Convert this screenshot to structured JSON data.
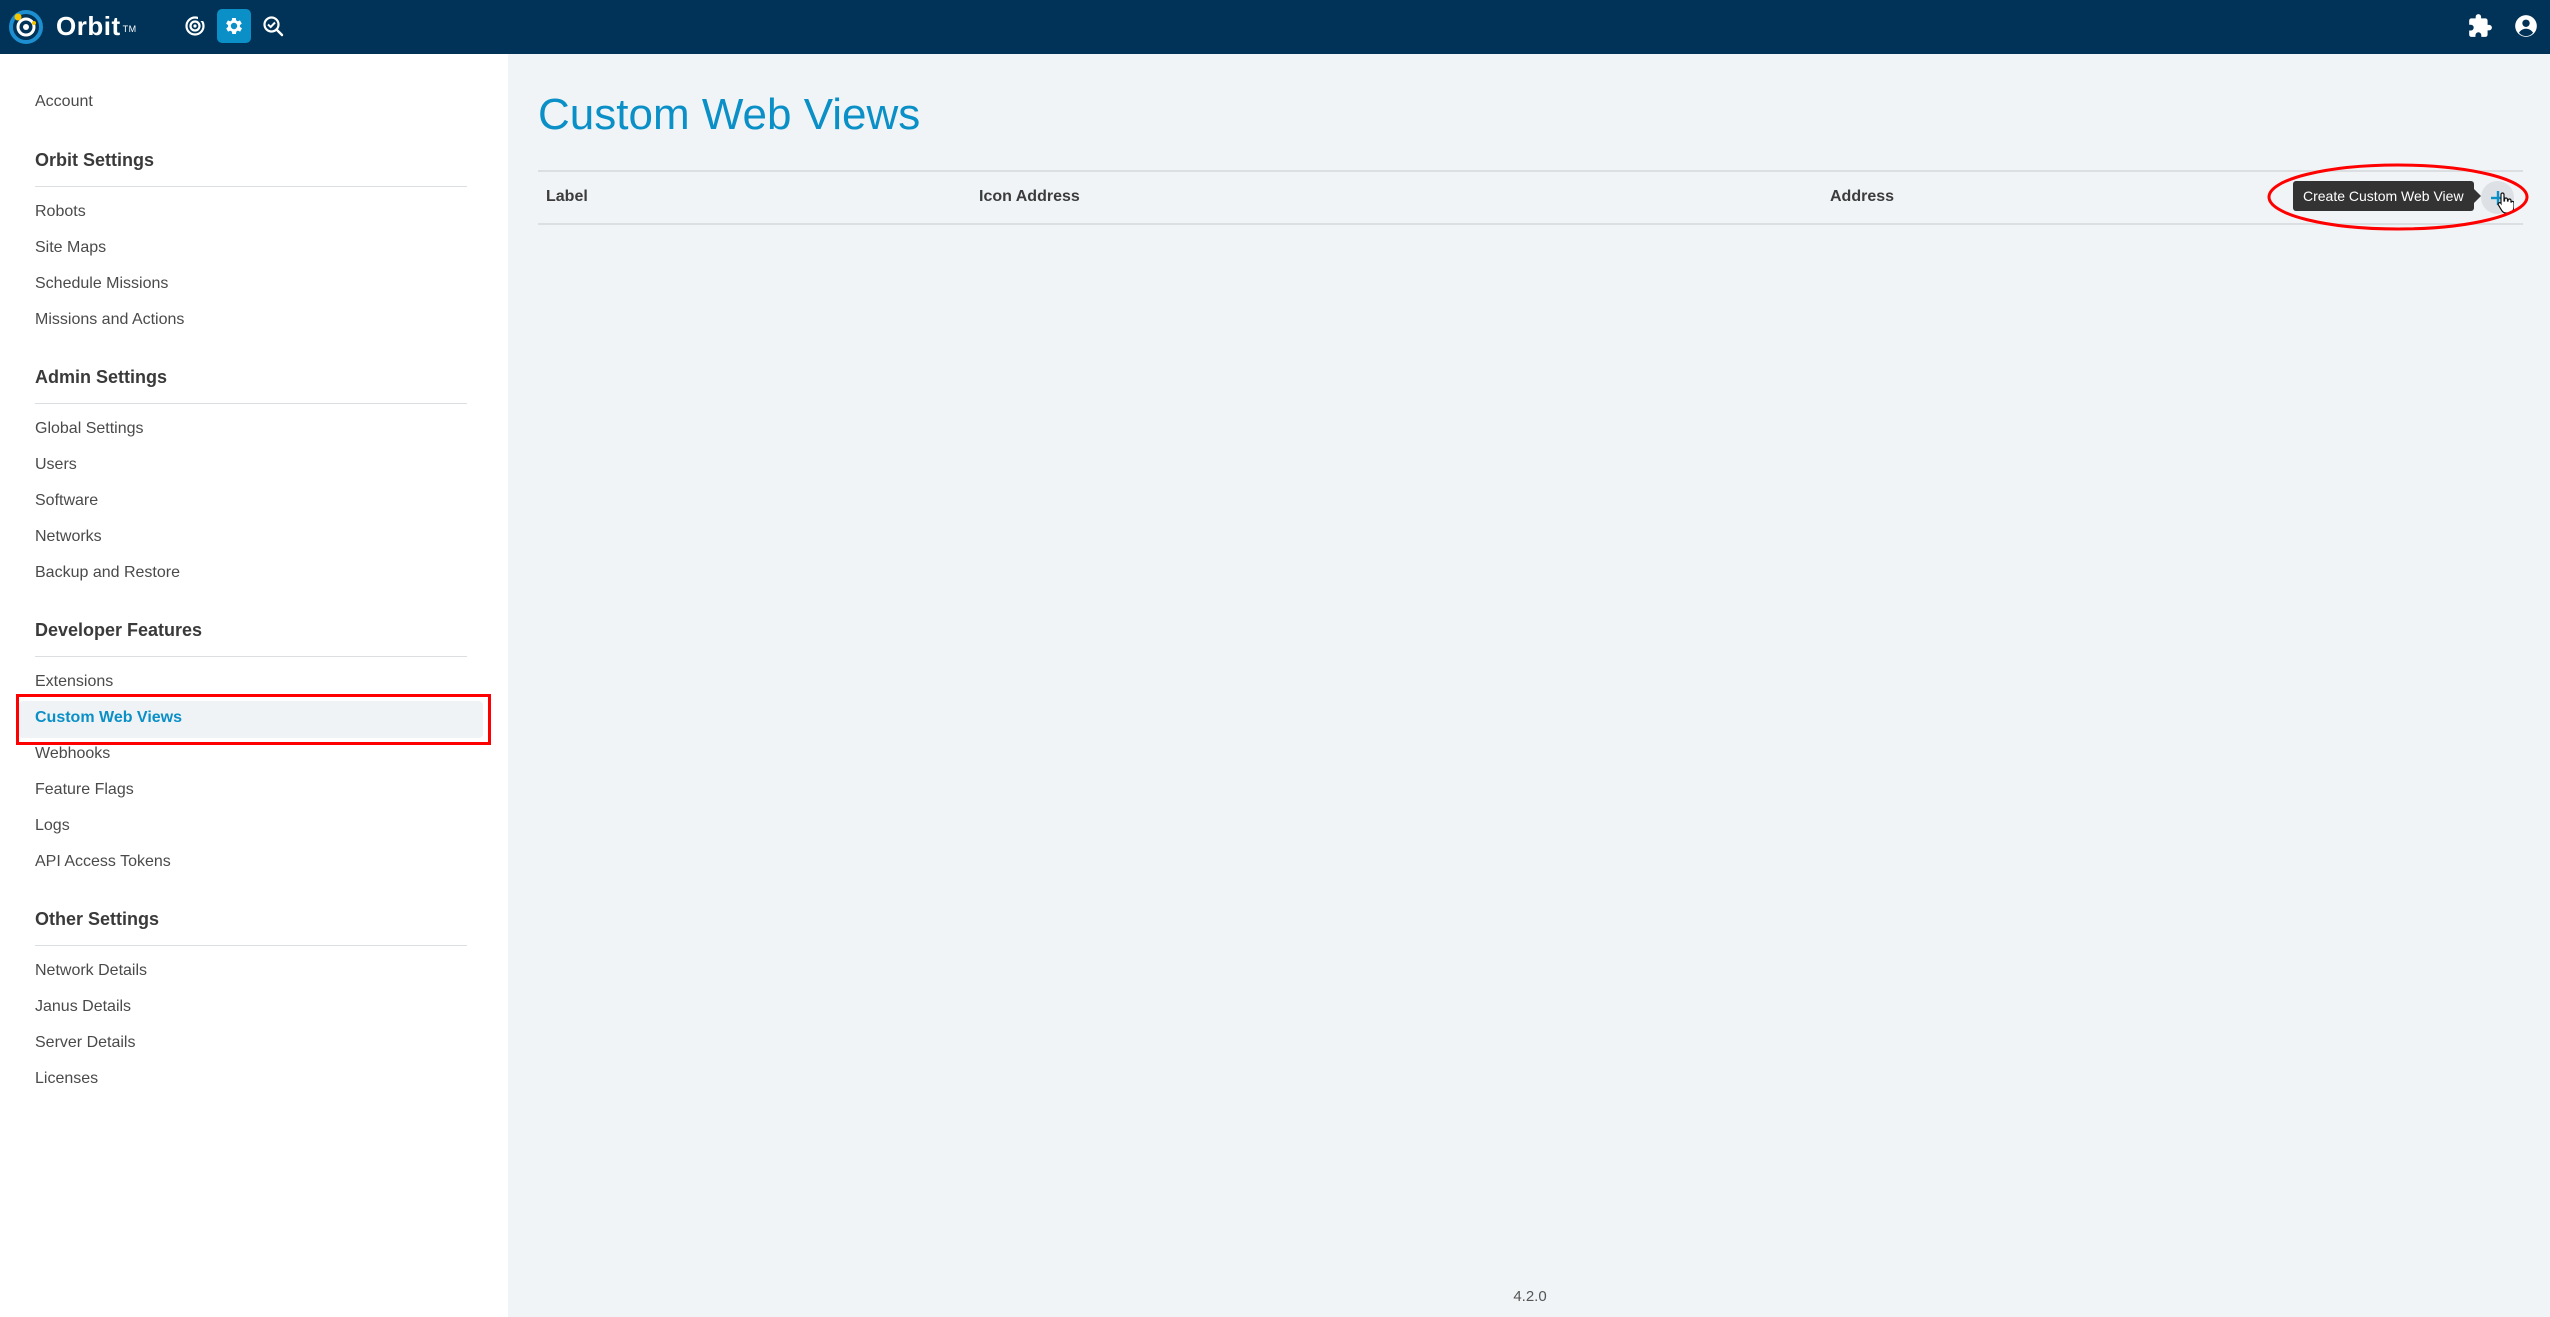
{
  "app": {
    "brand": "Orbit",
    "trademark": "TM",
    "colors": {
      "topbar": "#003357",
      "accent": "#0a8fc7",
      "annotation": "#ff0000"
    },
    "nav_icons": [
      {
        "name": "target-icon",
        "active": false
      },
      {
        "name": "gear-icon",
        "active": true
      },
      {
        "name": "search-check-icon",
        "active": false
      }
    ],
    "right_icons": [
      "puzzle-icon",
      "user-account-icon"
    ]
  },
  "sidebar": {
    "account": "Account",
    "sections": [
      {
        "title": "Orbit Settings",
        "items": [
          "Robots",
          "Site Maps",
          "Schedule Missions",
          "Missions and Actions"
        ]
      },
      {
        "title": "Admin Settings",
        "items": [
          "Global Settings",
          "Users",
          "Software",
          "Networks",
          "Backup and Restore"
        ]
      },
      {
        "title": "Developer Features",
        "items": [
          "Extensions",
          "Custom Web Views",
          "Webhooks",
          "Feature Flags",
          "Logs",
          "API Access Tokens"
        ]
      },
      {
        "title": "Other Settings",
        "items": [
          "Network Details",
          "Janus Details",
          "Server Details",
          "Licenses"
        ]
      }
    ],
    "active_item": "Custom Web Views"
  },
  "main": {
    "title": "Custom Web Views",
    "table": {
      "columns": [
        "Label",
        "Icon Address",
        "Address"
      ],
      "rows": []
    },
    "add_button_tooltip": "Create Custom Web View",
    "add_button_icon": "plus-icon"
  },
  "footer": {
    "version": "4.2.0"
  }
}
